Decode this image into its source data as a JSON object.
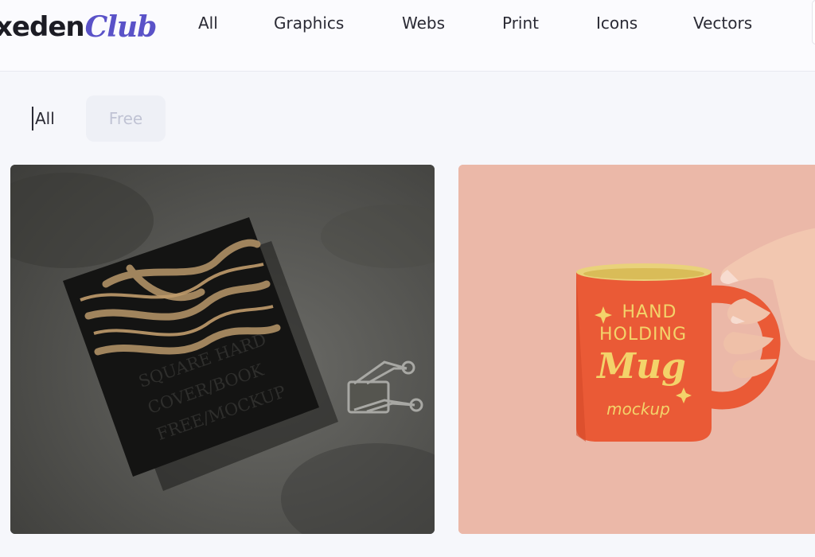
{
  "brand": {
    "logo_word": "xeden",
    "logo_script": "Club",
    "accent_color": "#5a52c8"
  },
  "nav": {
    "items": [
      "All",
      "Graphics",
      "Webs",
      "Print",
      "Icons",
      "Vectors"
    ]
  },
  "filters": {
    "all_label": "All",
    "free_label": "Free",
    "active": "All"
  },
  "cards": [
    {
      "name": "book-mockup",
      "image_text": [
        "SQUARE HARD",
        "COVER/BOOK",
        "FREE/MOCKUP"
      ]
    },
    {
      "name": "mug-mockup",
      "image_text": [
        "HAND",
        "HOLDING",
        "Mug",
        "mockup"
      ]
    }
  ]
}
